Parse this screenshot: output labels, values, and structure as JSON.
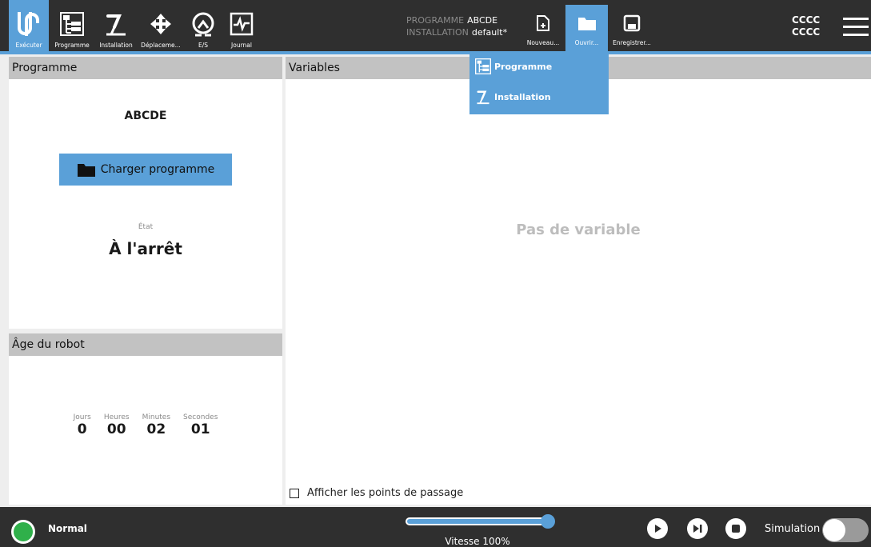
{
  "header": {
    "tabs": [
      {
        "label": "Exécuter",
        "icon": "ur-logo-icon"
      },
      {
        "label": "Programme",
        "icon": "program-tree-icon"
      },
      {
        "label": "Installation",
        "icon": "robot-arm-icon"
      },
      {
        "label": "Déplaceme...",
        "icon": "move-arrows-icon"
      },
      {
        "label": "E/S",
        "icon": "io-icon"
      },
      {
        "label": "Journal",
        "icon": "log-chart-icon"
      }
    ],
    "program_key": "PROGRAMME",
    "program_value": "ABCDE",
    "installation_key": "INSTALLATION",
    "installation_value": "default*",
    "file_buttons": [
      {
        "label": "Nouveau...",
        "icon": "new-file-icon"
      },
      {
        "label": "Ouvrir...",
        "icon": "folder-icon"
      },
      {
        "label": "Enregistrer...",
        "icon": "save-icon"
      }
    ],
    "user_line1": "CCCC",
    "user_line2": "CCCC"
  },
  "dropdown": {
    "items": [
      {
        "label": "Programme",
        "icon": "program-tree-icon"
      },
      {
        "label": "Installation",
        "icon": "robot-arm-icon"
      }
    ]
  },
  "programme_panel": {
    "title": "Programme",
    "program_name": "ABCDE",
    "load_button": "Charger programme",
    "state_label": "État",
    "state_value": "À l'arrêt"
  },
  "age_panel": {
    "title": "Âge du robot",
    "cells": [
      {
        "key": "Jours",
        "value": "0"
      },
      {
        "key": "Heures",
        "value": "00"
      },
      {
        "key": "Minutes",
        "value": "02"
      },
      {
        "key": "Secondes",
        "value": "01"
      }
    ]
  },
  "variables_panel": {
    "title": "Variables",
    "empty_text": "Pas de variable",
    "waypoints_label": "Afficher les points de passage",
    "waypoints_checked": false
  },
  "footer": {
    "status": "Normal",
    "status_color": "#2fb04a",
    "speed_text": "Vitesse 100%",
    "speed_fraction": 1.0,
    "simulation_label": "Simulation",
    "simulation_on": false
  },
  "colors": {
    "accent": "#5aa0d8",
    "header_bg": "#2f2f2f",
    "panel_head": "#c2c2c2"
  }
}
